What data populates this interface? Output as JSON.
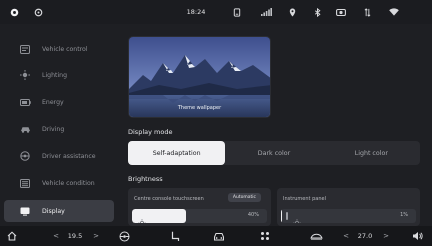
{
  "status_bar": {
    "time": "18:24",
    "icons": [
      "record-icon",
      "settings-icon",
      "phone-icon",
      "cellular-icon",
      "location-icon",
      "bluetooth-icon",
      "camera-icon",
      "data-icon",
      "wifi-icon"
    ]
  },
  "sidebar": {
    "items": [
      {
        "label": "Vehicle control",
        "icon": "car-control-icon",
        "active": false
      },
      {
        "label": "Lighting",
        "icon": "lighting-icon",
        "active": false
      },
      {
        "label": "Energy",
        "icon": "battery-icon",
        "active": false
      },
      {
        "label": "Driving",
        "icon": "steering-icon",
        "active": false
      },
      {
        "label": "Driver assistance",
        "icon": "assist-icon",
        "active": false
      },
      {
        "label": "Vehicle condition",
        "icon": "condition-icon",
        "active": false
      },
      {
        "label": "Display",
        "icon": "display-icon",
        "active": true
      }
    ]
  },
  "main": {
    "wallpaper": {
      "label": "Theme wallpaper"
    },
    "display_mode": {
      "title": "Display mode",
      "options": [
        "Self-adaptation",
        "Dark color",
        "Light color"
      ],
      "selected": "Self-adaptation"
    },
    "brightness": {
      "title": "Brightness",
      "cards": [
        {
          "label": "Centre console touchscreen",
          "tag": "Automatic",
          "value": "40%",
          "level": 0.4
        },
        {
          "label": "Instrument panel",
          "tag": "",
          "value": "1%",
          "level": 0.01
        }
      ]
    }
  },
  "dock": {
    "left_temp": "19.5",
    "right_temp": "27.0",
    "left_chevron_l": "<",
    "left_chevron_r": ">",
    "right_chevron_l": "<",
    "right_chevron_r": ">"
  },
  "colors": {
    "background": "#1e1f23",
    "active_item": "#3b3d44",
    "selected_option": "#f1f1f3",
    "text_primary": "#e4e5e8",
    "text_muted": "#8e9096"
  }
}
